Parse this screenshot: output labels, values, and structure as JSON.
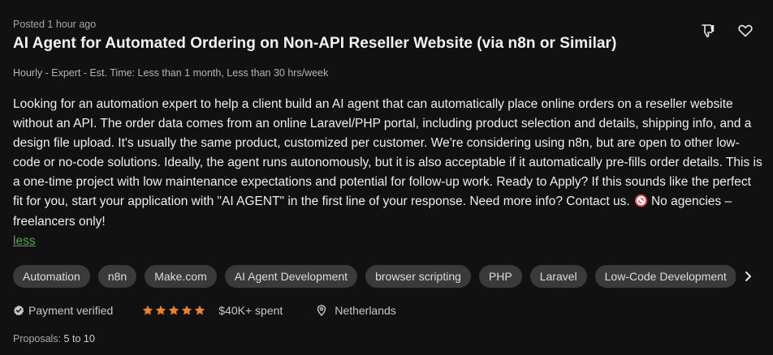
{
  "job": {
    "posted_prefix": "Posted",
    "posted_value": "1 hour ago",
    "title": "AI Agent for Automated Ordering on Non-API Reseller Website (via n8n or Similar)",
    "meta": "Hourly - Expert - Est. Time: Less than 1 month, Less than 30 hrs/week",
    "description": "Looking for an automation expert to help a client build an AI agent that can automatically place online orders on a reseller website without an API. The order data comes from an online Laravel/PHP portal, including product selection and details, shipping info, and a design file upload. It's usually the same product, customized per customer. We're considering using n8n, but are open to other low-code or no-code solutions. Ideally, the agent runs autonomously, but it is also acceptable if it automatically pre-fills order details. This is a one-time project with low maintenance expectations and potential for follow-up work. Ready to Apply? If this sounds like the perfect fit for you, start your application with \"AI AGENT\" in the first line of your response. Need more info? Contact us.",
    "description_tail": "No agencies – freelancers only!",
    "less_label": "less",
    "skills": [
      "Automation",
      "n8n",
      "Make.com",
      "AI Agent Development",
      "browser scripting",
      "PHP",
      "Laravel",
      "Low-Code Development"
    ],
    "payment_verified_label": "Payment verified",
    "rating_stars": 5,
    "spent": "$40K+ spent",
    "location": "Netherlands",
    "proposals_label": "Proposals:",
    "proposals_value": "5 to 10"
  },
  "icons": {
    "thumbs_down": "thumbs-down-icon",
    "heart": "heart-icon",
    "chevron_right": "chevron-right-icon",
    "verified": "verified-badge-icon",
    "star": "star-icon",
    "location": "location-pin-icon",
    "prohibited": "prohibited-emoji"
  },
  "colors": {
    "background": "#111111",
    "link_green": "#3fb03f",
    "star_orange": "#f2801e",
    "chip_bg": "#3a3a3a"
  }
}
